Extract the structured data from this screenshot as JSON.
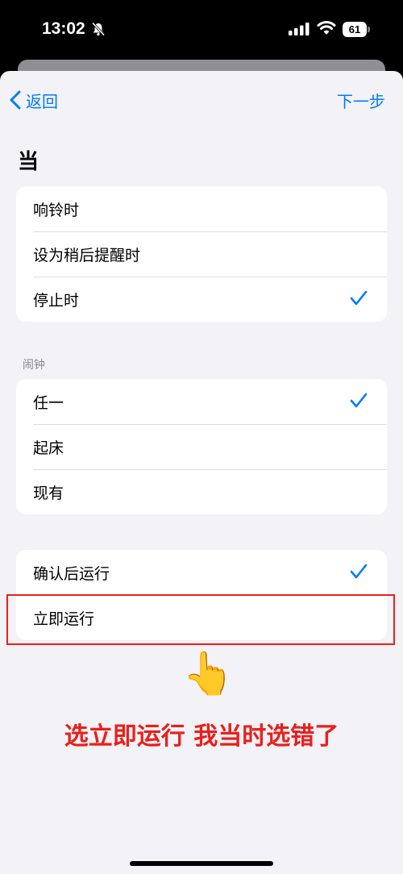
{
  "status_bar": {
    "time": "13:02",
    "battery": "61"
  },
  "nav": {
    "back_label": "返回",
    "next_label": "下一步"
  },
  "section_title": "当",
  "trigger_options": [
    {
      "label": "响铃时",
      "checked": false
    },
    {
      "label": "设为稍后提醒时",
      "checked": false
    },
    {
      "label": "停止时",
      "checked": true
    }
  ],
  "alarm_group": {
    "header": "闹钟",
    "options": [
      {
        "label": "任一",
        "checked": true
      },
      {
        "label": "起床",
        "checked": false
      },
      {
        "label": "现有",
        "checked": false
      }
    ]
  },
  "run_options": [
    {
      "label": "确认后运行",
      "checked": true
    },
    {
      "label": "立即运行",
      "checked": false
    }
  ],
  "annotation": {
    "hand": "👆",
    "caption": "选立即运行 我当时选错了",
    "color": "#e8201c"
  },
  "colors": {
    "accent": "#007aff",
    "background": "#f2f2f7"
  }
}
